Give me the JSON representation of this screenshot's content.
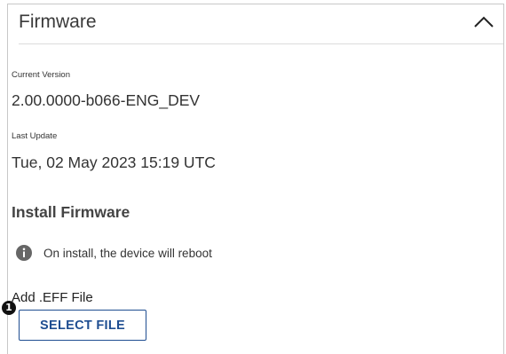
{
  "panel": {
    "title": "Firmware",
    "collapse_icon": "chevron-up-icon"
  },
  "current_version": {
    "label": "Current Version",
    "value": "2.00.0000-b066-ENG_DEV"
  },
  "last_update": {
    "label": "Last Update",
    "value": "Tue, 02 May 2023 15:19 UTC"
  },
  "install": {
    "heading": "Install Firmware",
    "info_icon": "info-icon",
    "info_text": "On install, the device will reboot",
    "file_label": "Add .EFF File",
    "callout_number": "1",
    "select_button_label": "SELECT FILE"
  },
  "colors": {
    "accent": "#1f4e91",
    "icon_gray": "#666666",
    "border": "#c8c8c8"
  }
}
